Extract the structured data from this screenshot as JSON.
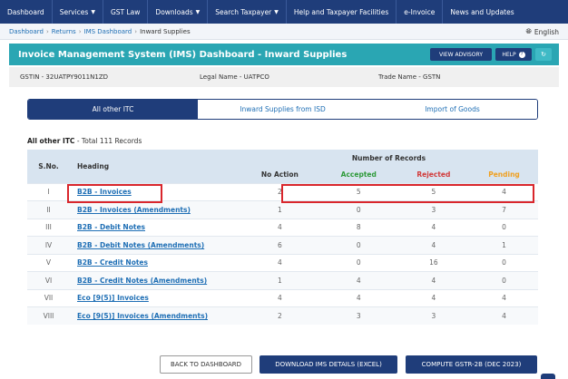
{
  "nav": {
    "items": [
      {
        "label": "Dashboard",
        "caret": false
      },
      {
        "label": "Services",
        "caret": true
      },
      {
        "label": "GST Law",
        "caret": false
      },
      {
        "label": "Downloads",
        "caret": true
      },
      {
        "label": "Search Taxpayer",
        "caret": true
      },
      {
        "label": "Help and Taxpayer Facilities",
        "caret": false
      },
      {
        "label": "e-Invoice",
        "caret": false
      },
      {
        "label": "News and Updates",
        "caret": false
      }
    ]
  },
  "breadcrumb": {
    "links": [
      "Dashboard",
      "Returns",
      "IMS Dashboard"
    ],
    "current": "Inward Supplies",
    "separator": "›",
    "language": "English"
  },
  "header": {
    "title": "Invoice Management System (IMS) Dashboard - Inward Supplies",
    "advisory_label": "VIEW ADVISORY",
    "help_label": "HELP",
    "help_icon": "question-circle-icon",
    "refresh_icon": "refresh-icon"
  },
  "taxpayer": {
    "gstin": "GSTIN - 32UATPY9011N1ZD",
    "legal_name": "Legal Name - UATPCO",
    "trade_name": "Trade Name - GSTN"
  },
  "tabs": [
    {
      "label": "All other ITC",
      "active": true
    },
    {
      "label": "Inward Supplies from ISD",
      "active": false
    },
    {
      "label": "Import of Goods",
      "active": false
    }
  ],
  "summary": {
    "bold": "All other ITC",
    "rest": " - Total 111 Records"
  },
  "table": {
    "headers": {
      "sno": "S.No.",
      "heading": "Heading",
      "group": "Number of Records",
      "no_action": "No Action",
      "accepted": "Accepted",
      "rejected": "Rejected",
      "pending": "Pending"
    },
    "rows": [
      {
        "sno": "I",
        "heading": "B2B - Invoices",
        "no_action": "2",
        "accepted": "5",
        "rejected": "5",
        "pending": "4"
      },
      {
        "sno": "II",
        "heading": "B2B - Invoices (Amendments)",
        "no_action": "1",
        "accepted": "0",
        "rejected": "3",
        "pending": "7"
      },
      {
        "sno": "III",
        "heading": "B2B - Debit Notes",
        "no_action": "4",
        "accepted": "8",
        "rejected": "4",
        "pending": "0"
      },
      {
        "sno": "IV",
        "heading": "B2B - Debit Notes (Amendments)",
        "no_action": "6",
        "accepted": "0",
        "rejected": "4",
        "pending": "1"
      },
      {
        "sno": "V",
        "heading": "B2B - Credit Notes",
        "no_action": "4",
        "accepted": "0",
        "rejected": "16",
        "pending": "0"
      },
      {
        "sno": "VI",
        "heading": "B2B - Credit Notes (Amendments)",
        "no_action": "1",
        "accepted": "4",
        "rejected": "4",
        "pending": "0"
      },
      {
        "sno": "VII",
        "heading": "Eco [9(5)] Invoices",
        "no_action": "4",
        "accepted": "4",
        "rejected": "4",
        "pending": "4"
      },
      {
        "sno": "VIII",
        "heading": "Eco [9(5)] Invoices (Amendments)",
        "no_action": "2",
        "accepted": "3",
        "rejected": "3",
        "pending": "4"
      }
    ]
  },
  "footer": {
    "back_label": "BACK TO DASHBOARD",
    "download_label": "DOWNLOAD IMS DETAILS (EXCEL)",
    "compute_label": "COMPUTE GSTR-2B (DEC 2023)"
  },
  "colors": {
    "nav_bg": "#1f3d7a",
    "title_bg": "#2aa6b3",
    "accepted": "#2e9a3a",
    "rejected": "#d23a3a",
    "pending": "#f0a020",
    "highlight_box": "#d9262c"
  }
}
